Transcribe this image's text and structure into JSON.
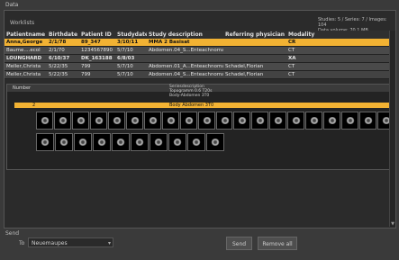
{
  "window": {
    "title": "Data"
  },
  "panel": {
    "title": "Worklists"
  },
  "stats": {
    "line1": "Studies: 5 / Series: 7 / Images: 104",
    "line2": "Data volume: 70.1 MB"
  },
  "table": {
    "headers": [
      "Patientname",
      "Birthdate",
      "Patient ID",
      "Studydate",
      "Study description",
      "Referring physician",
      "Modality"
    ],
    "rows": [
      {
        "name": "Anna,George",
        "birth": "2/1/78",
        "id": "89_347",
        "date": "3/10/11",
        "desc": "MMA 2 Basisat",
        "phys": "",
        "mod": "CR"
      },
      {
        "name": "Baume....ecol",
        "birth": "2/1/70",
        "id": "1234567890",
        "date": "5/7/10",
        "desc": "Abdomen.04_S...Enteachnomaci",
        "phys": "",
        "mod": "CT"
      },
      {
        "name": "LOUNGHARD",
        "birth": "6/10/37",
        "id": "DK_163188",
        "date": "6/8/03",
        "desc": "",
        "phys": "",
        "mod": "XA"
      },
      {
        "name": "Meller,Christa",
        "birth": "5/22/35",
        "id": "799",
        "date": "5/7/10",
        "desc": "Abdomen.01_A...Enteachnomaci",
        "phys": "Schadel,Florian",
        "mod": "CT"
      },
      {
        "name": "Meller,Christa",
        "birth": "5/22/35",
        "id": "799",
        "date": "5/7/10",
        "desc": "Abdomen.04_S...Enteachnomaci",
        "phys": "Schadel,Florian",
        "mod": "CT"
      }
    ]
  },
  "series": {
    "header_label": "Number",
    "info_line1": "Seriesdescription",
    "info_line2": "Topogramm 0.6 T20s",
    "info_line3": "Body-Abdomen 3T0",
    "selected_number": "2",
    "selected_desc": "Body Abdomen 3T0",
    "row1_count": 20,
    "row2_count": 10
  },
  "send": {
    "section_label": "Send",
    "to_label": "To",
    "destination": "Neuemaupes",
    "send_button": "Send",
    "send_all_button": "Remove all"
  }
}
